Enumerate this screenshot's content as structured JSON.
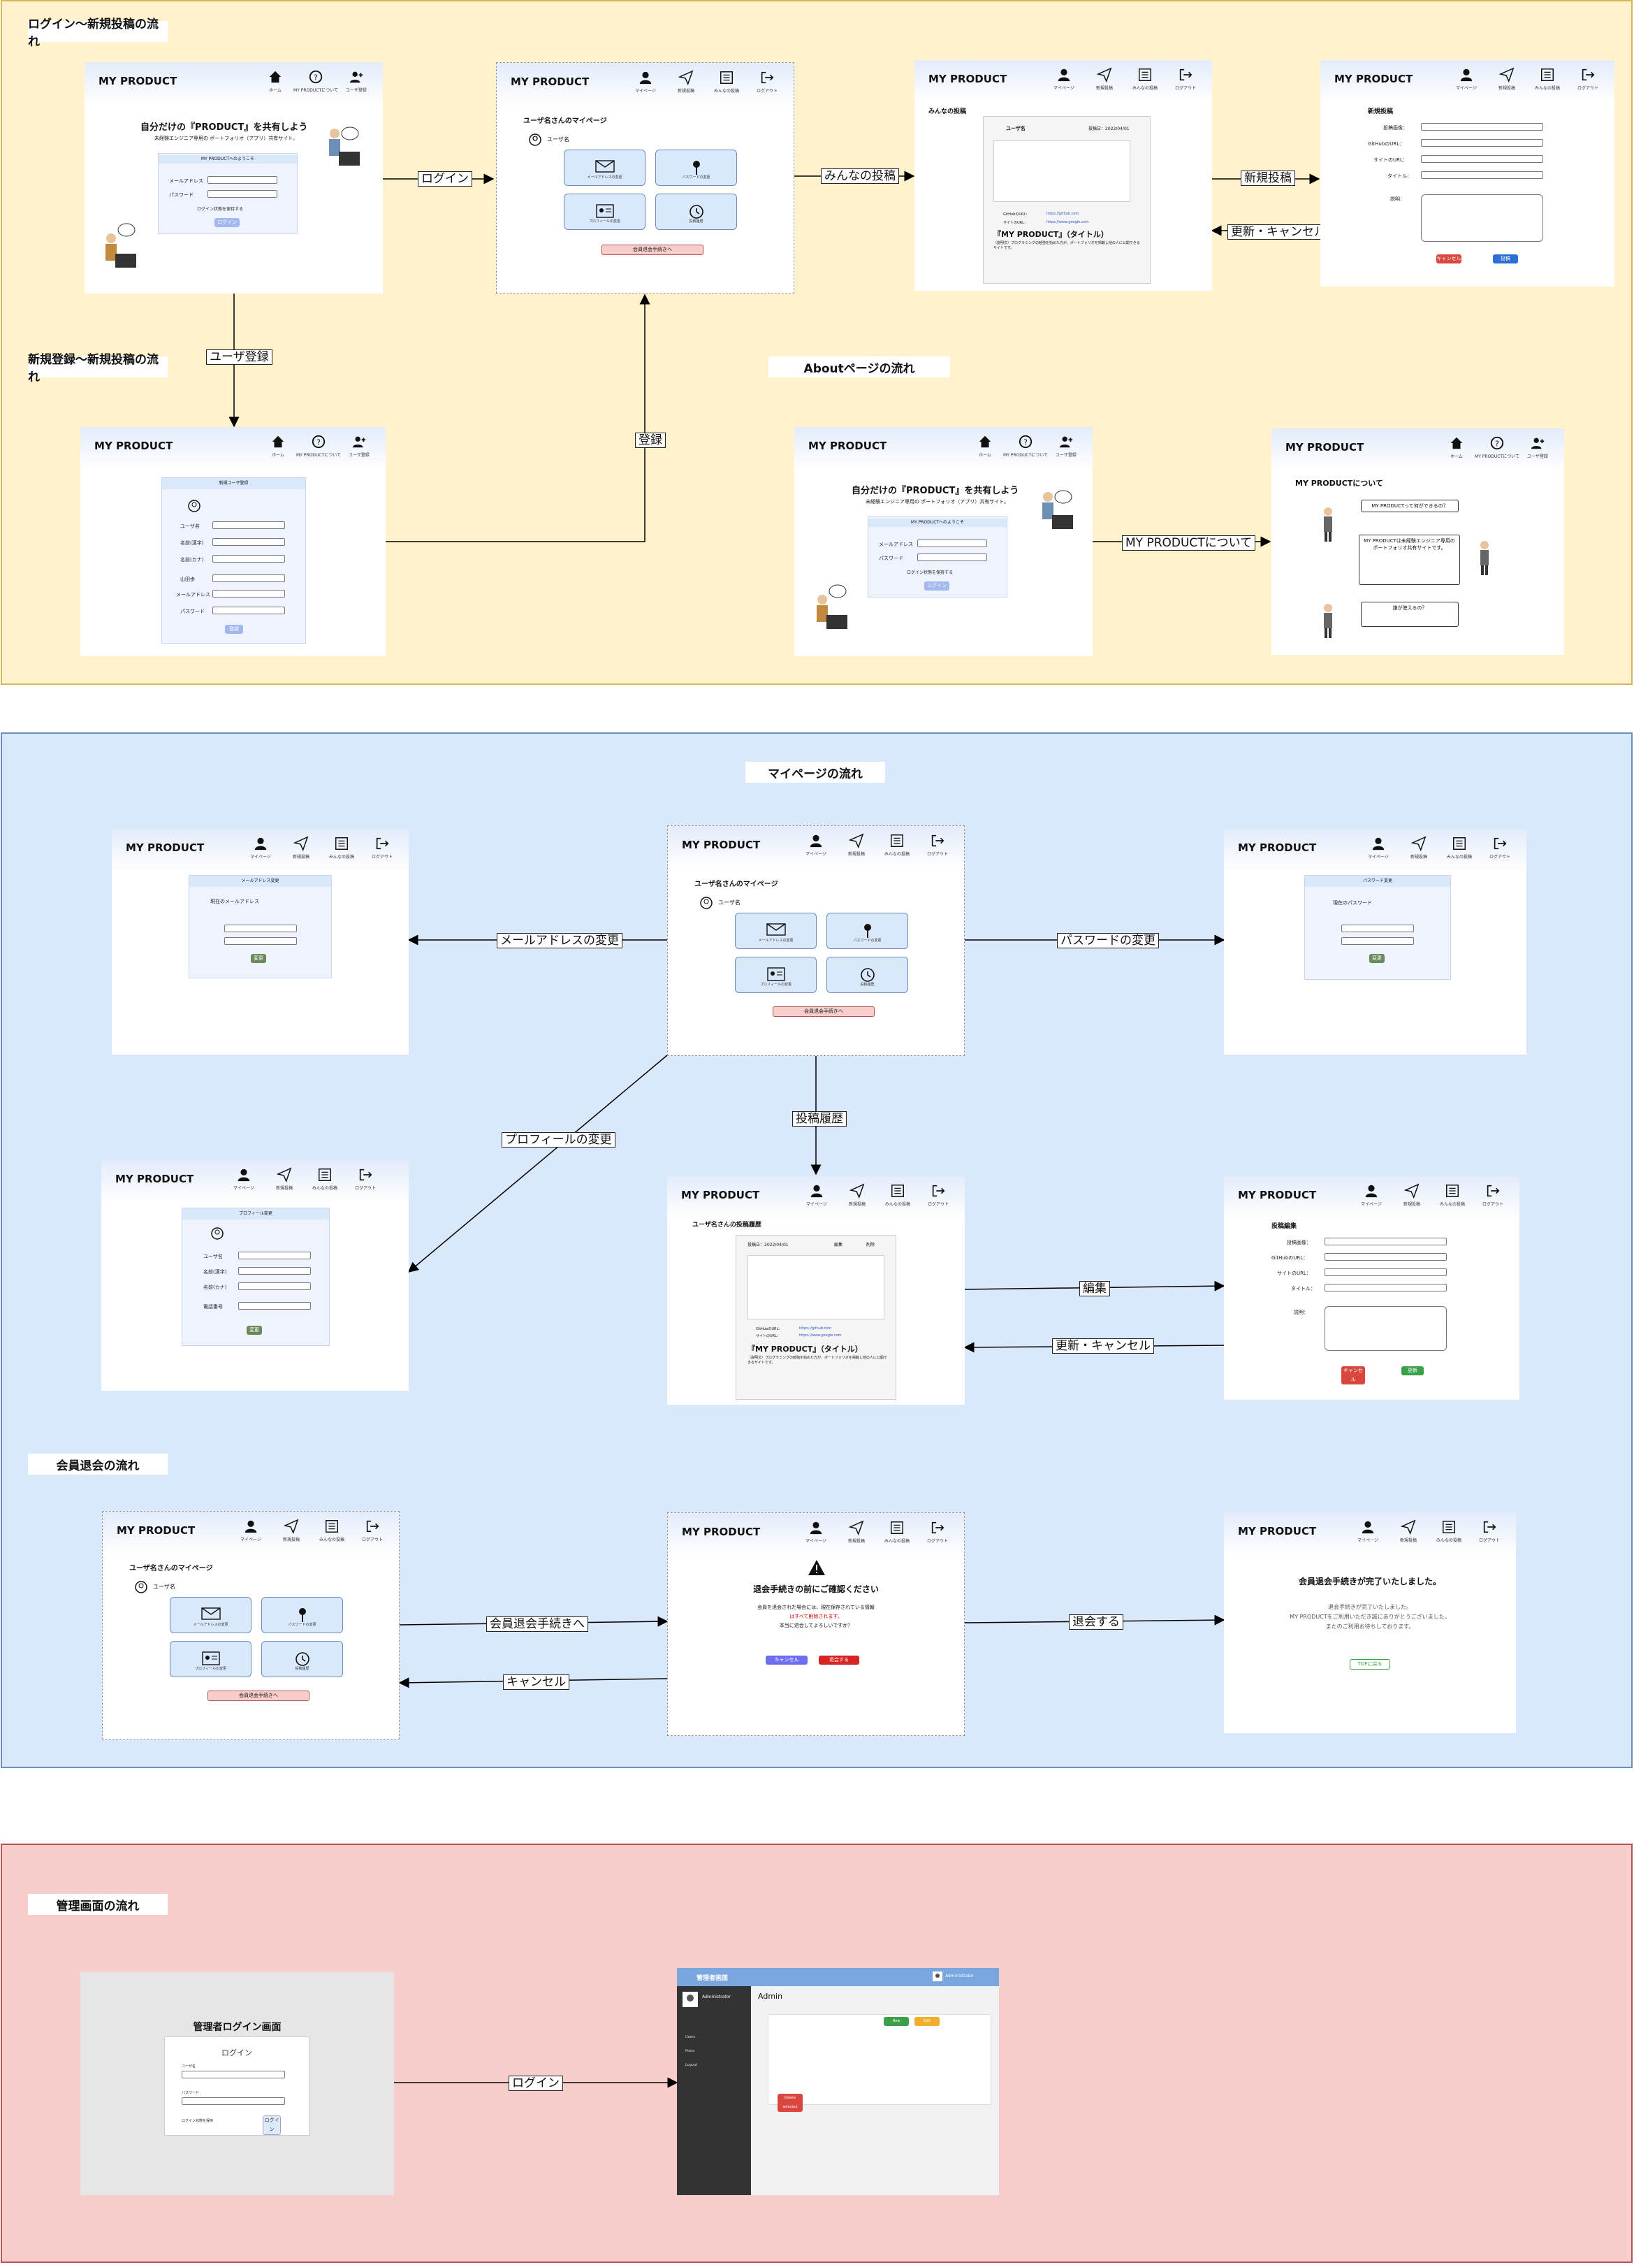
{
  "brand": "MY PRODUCT",
  "nav_user": [
    "マイページ",
    "新規投稿",
    "みんなの投稿",
    "ログアウト"
  ],
  "nav_guest": [
    "ホーム",
    "MY PRODUCTについて",
    "ユーザ登録"
  ],
  "sections": {
    "login_flow": "ログイン〜新規投稿の流れ",
    "signup_flow": "新規登録〜新規投稿の流れ",
    "about_flow": "Aboutページの流れ",
    "mypage_flow": "マイページの流れ",
    "withdraw_flow": "会員退会の流れ",
    "admin_flow": "管理画面の流れ"
  },
  "edges": {
    "login": "ログイン",
    "all_posts": "みんなの投稿",
    "new_post": "新規投稿",
    "update_cancel": "更新・キャンセル",
    "register_user": "ユーザ登録",
    "register": "登録",
    "about": "MY PRODUCTについて",
    "email_change": "メールアドレスの変更",
    "password_change": "パスワードの変更",
    "profile_change": "プロフィールの変更",
    "post_history": "投稿履歴",
    "edit": "編集",
    "edit_cancel": "更新・キャンセル",
    "withdraw_proc": "会員退会手続きへ",
    "cancel": "キャンセル",
    "withdraw": "退会する",
    "admin_login": "ログイン"
  },
  "home": {
    "title": "自分だけの『PRODUCT』を共有しよう",
    "sub": "未経験エンジニア専用の ポートフォリオ（アプリ）共有サイト。",
    "box_title": "MY PRODUCTへのようこそ",
    "email": "メールアドレス",
    "password": "パスワード",
    "remember": "ログイン状態を保持する",
    "login_btn": "ログイン"
  },
  "mypage": {
    "title": "ユーザ名さんのマイページ",
    "username": "ユーザ名",
    "cards": [
      "メールアドレスの変更",
      "パスワードの変更",
      "プロフィールの変更",
      "投稿履歴"
    ],
    "withdraw": "会員退会手続きへ"
  },
  "all_posts": {
    "title": "みんなの投稿",
    "username": "ユーザ名",
    "date": "投稿日：2022/04/01",
    "github": "GitHubのURL：",
    "site": "サイトのURL：",
    "github_val": "https://github.com",
    "site_val": "https://www.google.com",
    "post_title": "『MY PRODUCT』（タイトル）",
    "body": "〈説明文〉プログラミングの勉強を始めた方が、ポートフォリオを掲載し他の人に公開できるサイトです。"
  },
  "new_post": {
    "title": "新規投稿",
    "fields": [
      "投稿画像：",
      "GitHubのURL：",
      "サイトのURL：",
      "タイトル：",
      "説明："
    ],
    "cancel": "キャンセル",
    "submit": "投稿"
  },
  "signup": {
    "box_title": "新規ユーザ登録",
    "fields": [
      "ユーザ名",
      "名前(漢字)",
      "名前(カナ)",
      "山田歩",
      "メールアドレス",
      "パスワード"
    ],
    "submit": "登録"
  },
  "about": {
    "title": "MY PRODUCTについて",
    "q1": "MY PRODUCTって何ができるの？",
    "a1": "MY PRODUCTは未経験エンジニア専用のポートフォリオ共有サイトです。",
    "q2": "誰が使えるの？"
  },
  "email_change": {
    "title": "メールアドレス変更",
    "current": "現在のメールアドレス",
    "submit": "変更"
  },
  "password_change": {
    "title": "パスワード変更",
    "current": "現在のパスワード",
    "submit": "変更"
  },
  "profile_change": {
    "title": "プロフィール変更",
    "fields": [
      "ユーザ名",
      "名前(漢字)",
      "名前(カナ)",
      "電話番号"
    ],
    "submit": "変更"
  },
  "history": {
    "title": "ユーザ名さんの投稿履歴",
    "date": "投稿日：2022/04/01",
    "edit": "編集",
    "del": "削除",
    "post_title": "『MY PRODUCT』（タイトル）"
  },
  "edit": {
    "title": "投稿編集",
    "fields": [
      "投稿画像：",
      "GitHubのURL：",
      "サイトのURL：",
      "タイトル：",
      "説明："
    ],
    "cancel": "キャンセル",
    "submit": "更新"
  },
  "withdraw_confirm": {
    "title": "退会手続きの前にご確認ください",
    "l1": "会員を退会された場合には、現在保存されている情報",
    "l2": "はすべて削除されます。",
    "l3": "本当に退会してよろしいですか？",
    "cancel": "キャンセル",
    "ok": "退会する"
  },
  "withdraw_done": {
    "title": "会員退会手続きが完了いたしました。",
    "l1": "退会手続きが完了いたしました。",
    "l2": "MY PRODUCTをご利用いただき誠にありがとうございました。",
    "l3": "またのご利用お待ちしております。",
    "link": "TOPに戻る"
  },
  "admin_login": {
    "title": "管理者ログイン画面",
    "box": "ログイン",
    "user": "ユーザ名",
    "pass": "パスワード",
    "remember": "ログイン状態を保持",
    "btn": "ログイン"
  },
  "admin": {
    "header": "管理者画面",
    "user": "Administrator",
    "page": "Admin",
    "menu": [
      "Users",
      "Posts",
      "Logout"
    ],
    "add": "New",
    "edit": "Edit",
    "del": "Delete selected"
  }
}
